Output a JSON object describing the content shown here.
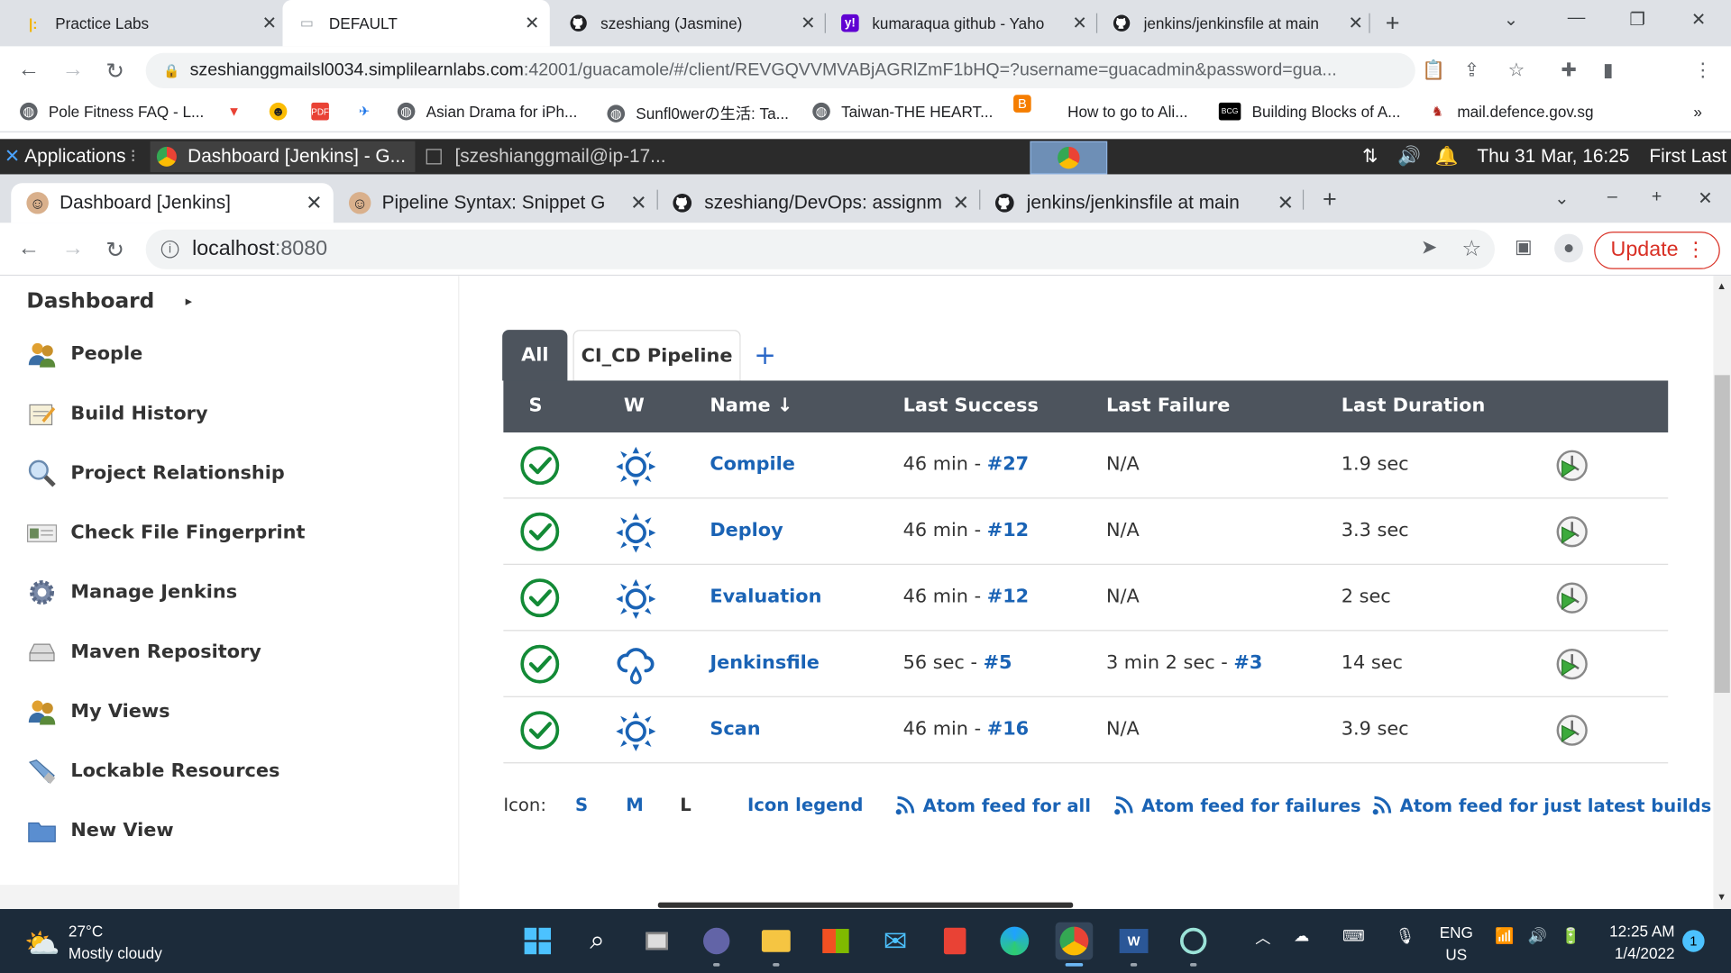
{
  "outer_browser": {
    "tabs": [
      {
        "title": "Practice Labs"
      },
      {
        "title": "DEFAULT"
      },
      {
        "title": "szeshiang (Jasmine)"
      },
      {
        "title": "kumaraqua github - Yaho"
      },
      {
        "title": "jenkins/jenkinsfile at main"
      }
    ],
    "url_domain": "szeshianggmailsl0034.simplilearnlabs.com",
    "url_path": ":42001/guacamole/#/client/REVGQVVMVABjAGRlZmF1bHQ=?username=guacadmin&password=gua...",
    "bookmarks": [
      {
        "label": "Pole Fitness FAQ - L..."
      },
      {
        "label": "Asian Drama for iPh..."
      },
      {
        "label": "Sunfl0werの生活: Ta..."
      },
      {
        "label": "Taiwan-THE HEART..."
      },
      {
        "label": "How to go to Ali..."
      },
      {
        "label": "Building Blocks of A..."
      },
      {
        "label": "mail.defence.gov.sg"
      }
    ],
    "bookmarks_more": "»"
  },
  "remote_panel": {
    "applications": "Applications",
    "task1": "Dashboard [Jenkins] - G...",
    "task2": "[szeshianggmail@ip-17...",
    "datetime": "Thu 31 Mar, 16:25",
    "user": "First Last"
  },
  "inner_browser": {
    "tabs": [
      {
        "title": "Dashboard [Jenkins]"
      },
      {
        "title": "Pipeline Syntax: Snippet G"
      },
      {
        "title": "szeshiang/DevOps: assignm"
      },
      {
        "title": "jenkins/jenkinsfile at main"
      }
    ],
    "url_host": "localhost",
    "url_port": ":8080",
    "update_label": "Update"
  },
  "jenkins": {
    "breadcrumb": "Dashboard",
    "sidebar": [
      {
        "label": "People",
        "icon": "people-icon"
      },
      {
        "label": "Build History",
        "icon": "notepad-icon"
      },
      {
        "label": "Project Relationship",
        "icon": "magnifier-icon"
      },
      {
        "label": "Check File Fingerprint",
        "icon": "fingerprint-card-icon"
      },
      {
        "label": "Manage Jenkins",
        "icon": "gear-icon"
      },
      {
        "label": "Maven Repository",
        "icon": "drive-icon"
      },
      {
        "label": "My Views",
        "icon": "people-icon"
      },
      {
        "label": "Lockable Resources",
        "icon": "usb-key-icon"
      },
      {
        "label": "New View",
        "icon": "folder-icon"
      }
    ],
    "view_tabs": {
      "all": "All",
      "cicd": "CI_CD Pipeline",
      "add": "+"
    },
    "columns": {
      "s": "S",
      "w": "W",
      "name": "Name ↓",
      "last_success": "Last Success",
      "last_failure": "Last Failure",
      "last_duration": "Last Duration"
    },
    "jobs": [
      {
        "name": "Compile",
        "success_time": "46 min - ",
        "success_build": "#27",
        "failure_time": "N/A",
        "failure_build": "",
        "duration": "1.9 sec",
        "weather": "sunny"
      },
      {
        "name": "Deploy",
        "success_time": "46 min - ",
        "success_build": "#12",
        "failure_time": "N/A",
        "failure_build": "",
        "duration": "3.3 sec",
        "weather": "sunny"
      },
      {
        "name": "Evaluation",
        "success_time": "46 min - ",
        "success_build": "#12",
        "failure_time": "N/A",
        "failure_build": "",
        "duration": "2 sec",
        "weather": "sunny"
      },
      {
        "name": "Jenkinsfile",
        "success_time": "56 sec - ",
        "success_build": "#5",
        "failure_time": "3 min 2 sec - ",
        "failure_build": "#3",
        "duration": "14 sec",
        "weather": "rainy"
      },
      {
        "name": "Scan",
        "success_time": "46 min - ",
        "success_build": "#16",
        "failure_time": "N/A",
        "failure_build": "",
        "duration": "3.9 sec",
        "weather": "sunny"
      }
    ],
    "legend": {
      "icon_label": "Icon:",
      "s": "S",
      "m": "M",
      "l": "L",
      "icon_legend": "Icon legend",
      "feed_all": "Atom feed for all",
      "feed_failures": "Atom feed for failures",
      "feed_latest": "Atom feed for just latest builds"
    },
    "colors": {
      "header": "#4d545d",
      "link": "#1a63b5",
      "success": "#138a36"
    }
  },
  "taskbar": {
    "temp": "27°C",
    "weather": "Mostly cloudy",
    "lang1": "ENG",
    "lang2": "US",
    "time": "12:25 AM",
    "date": "1/4/2022",
    "notifications": "1"
  }
}
